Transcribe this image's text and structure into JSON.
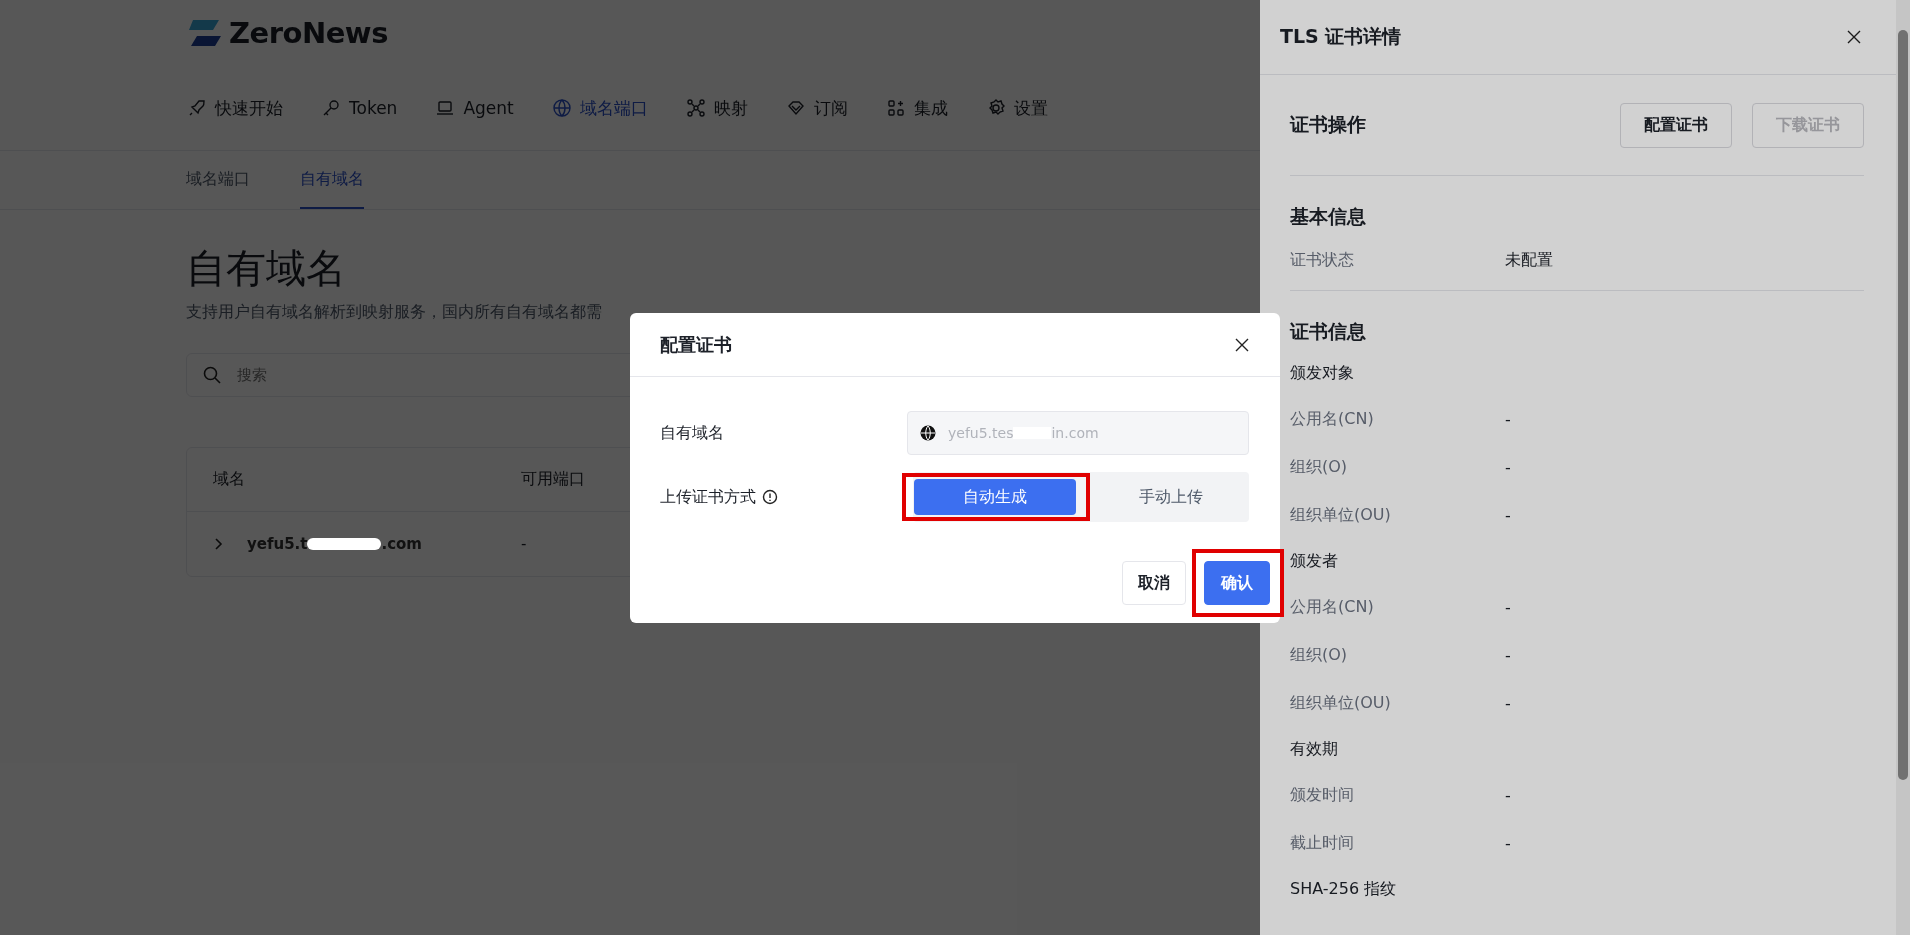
{
  "logo": {
    "text": "ZeroNews"
  },
  "nav": [
    {
      "label": "快速开始",
      "selected": false
    },
    {
      "label": "Token",
      "selected": false
    },
    {
      "label": "Agent",
      "selected": false
    },
    {
      "label": "域名端口",
      "selected": true
    },
    {
      "label": "映射",
      "selected": false
    },
    {
      "label": "订阅",
      "selected": false
    },
    {
      "label": "集成",
      "selected": false
    },
    {
      "label": "设置",
      "selected": false
    }
  ],
  "subtabs": [
    {
      "label": "域名端口",
      "selected": false
    },
    {
      "label": "自有域名",
      "selected": true
    }
  ],
  "page": {
    "title": "自有域名",
    "description": "支持用户自有域名解析到映射服务，国内所有自有域名都需"
  },
  "search": {
    "placeholder": "搜索"
  },
  "table": {
    "columns": [
      "域名",
      "可用端口"
    ],
    "rows": [
      {
        "expanded": false,
        "domain_start": "yefu5.t",
        "domain_end": ".com",
        "port": "-"
      }
    ]
  },
  "drawer": {
    "title": "TLS 证书详情",
    "actions_heading": "证书操作",
    "buttons": [
      {
        "label": "配置证书",
        "disabled": false
      },
      {
        "label": "下载证书",
        "disabled": true
      }
    ],
    "sections": [
      {
        "heading": "基本信息",
        "items": [
          {
            "kind": "field",
            "label": "证书状态",
            "value": "未配置"
          }
        ]
      },
      {
        "heading": "证书信息",
        "items": [
          {
            "kind": "group",
            "label": "颁发对象"
          },
          {
            "kind": "field",
            "label": "公用名(CN)",
            "value": "-"
          },
          {
            "kind": "field",
            "label": "组织(O)",
            "value": "-"
          },
          {
            "kind": "field",
            "label": "组织单位(OU)",
            "value": "-"
          },
          {
            "kind": "group",
            "label": "颁发者"
          },
          {
            "kind": "field",
            "label": "公用名(CN)",
            "value": "-"
          },
          {
            "kind": "field",
            "label": "组织(O)",
            "value": "-"
          },
          {
            "kind": "field",
            "label": "组织单位(OU)",
            "value": "-"
          },
          {
            "kind": "group",
            "label": "有效期"
          },
          {
            "kind": "field",
            "label": "颁发时间",
            "value": "-"
          },
          {
            "kind": "field",
            "label": "截止时间",
            "value": "-"
          },
          {
            "kind": "group",
            "label": "SHA-256 指纹"
          }
        ]
      }
    ]
  },
  "dialog": {
    "title": "配置证书",
    "domain": {
      "label": "自有域名",
      "value_start": "yefu5.tes",
      "value_end": "in.com",
      "disabled": true
    },
    "method": {
      "label": "上传证书方式",
      "options": [
        {
          "label": "自动生成",
          "selected": true,
          "highlighted": true
        },
        {
          "label": "手动上传",
          "selected": false,
          "highlighted": false
        }
      ]
    },
    "buttons": [
      {
        "label": "取消",
        "kind": "default",
        "highlighted": false
      },
      {
        "label": "确认",
        "kind": "primary",
        "highlighted": true
      }
    ]
  }
}
